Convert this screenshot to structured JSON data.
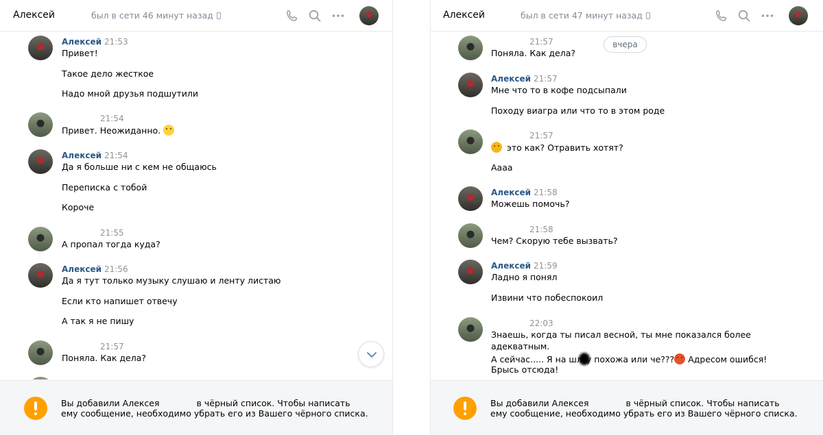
{
  "left": {
    "header": {
      "name": "Алексей",
      "status": "был в сети 46 минут назад"
    },
    "messages": [
      {
        "author": "Алексей",
        "time": "21:53",
        "lines": [
          "Привет!",
          "Такое дело жесткое",
          "Надо мной друзья подшутили"
        ]
      },
      {
        "author": "",
        "time": "21:54",
        "lines": [
          "Привет. Неожиданно."
        ],
        "emoji": "thinking-face"
      },
      {
        "author": "Алексей",
        "time": "21:54",
        "lines": [
          "Да я больше ни с кем не общаюсь",
          "Переписка с тобой",
          "Короче"
        ]
      },
      {
        "author": "",
        "time": "21:55",
        "lines": [
          "А пропал тогда куда?"
        ]
      },
      {
        "author": "Алексей",
        "time": "21:56",
        "lines": [
          "Да я тут только музыку слушаю и ленту листаю",
          "Если кто напишет отвечу",
          "А так я не пишу"
        ]
      },
      {
        "author": "",
        "time": "21:57",
        "lines": [
          "Поняла. Как дела?"
        ]
      }
    ],
    "notice": {
      "part1": "Вы добавили Алексея",
      "part2": "в чёрный список. Чтобы написать ему сообщение, необходимо убрать его из Вашего чёрного списка."
    }
  },
  "right": {
    "header": {
      "name": "Алексей",
      "status": "был в сети 47 минут назад"
    },
    "date_pill": "вчера",
    "messages": [
      {
        "author": "",
        "time": "21:57",
        "lines": [
          "Поняла. Как дела?"
        ]
      },
      {
        "author": "Алексей",
        "time": "21:57",
        "lines": [
          "Мне что то в кофе подсыпали",
          "Походу виагра или что то в этом роде"
        ]
      },
      {
        "author": "",
        "time": "21:57",
        "lines": [
          "это как? Отравить хотят?",
          "Аааа"
        ],
        "emoji": "upside-down-face"
      },
      {
        "author": "Алексей",
        "time": "21:58",
        "lines": [
          "Можешь помочь?"
        ]
      },
      {
        "author": "",
        "time": "21:58",
        "lines": [
          "Чем? Скорую тебе вызвать?"
        ]
      },
      {
        "author": "Алексей",
        "time": "21:59",
        "lines": [
          "Ладно я понял",
          "Извини что побеспокоил"
        ]
      },
      {
        "author": "",
        "time": "22:03",
        "lines": [
          "Знаешь, когда ты писал весной, ты мне показался более",
          "адекватным.",
          "А сейчас..... Я на шл",
          "у похожа или че???",
          "Адресом ошибся!",
          "Брысь отсюда!"
        ],
        "emoji": "angry-face"
      }
    ],
    "notice": {
      "part1": "Вы добавили Алексея",
      "part2": "в чёрный список. Чтобы написать ему сообщение, необходимо убрать его из Вашего чёрного списка."
    }
  },
  "icons": [
    "phone-icon",
    "search-icon",
    "more-icon",
    "chevron-down-icon",
    "warning-icon",
    "mobile-device-icon"
  ],
  "colors": {
    "author": "#2a5885",
    "time": "#939393",
    "status": "#818c99",
    "warning": "#ffa000",
    "footer_bg": "#f5f6f8"
  }
}
